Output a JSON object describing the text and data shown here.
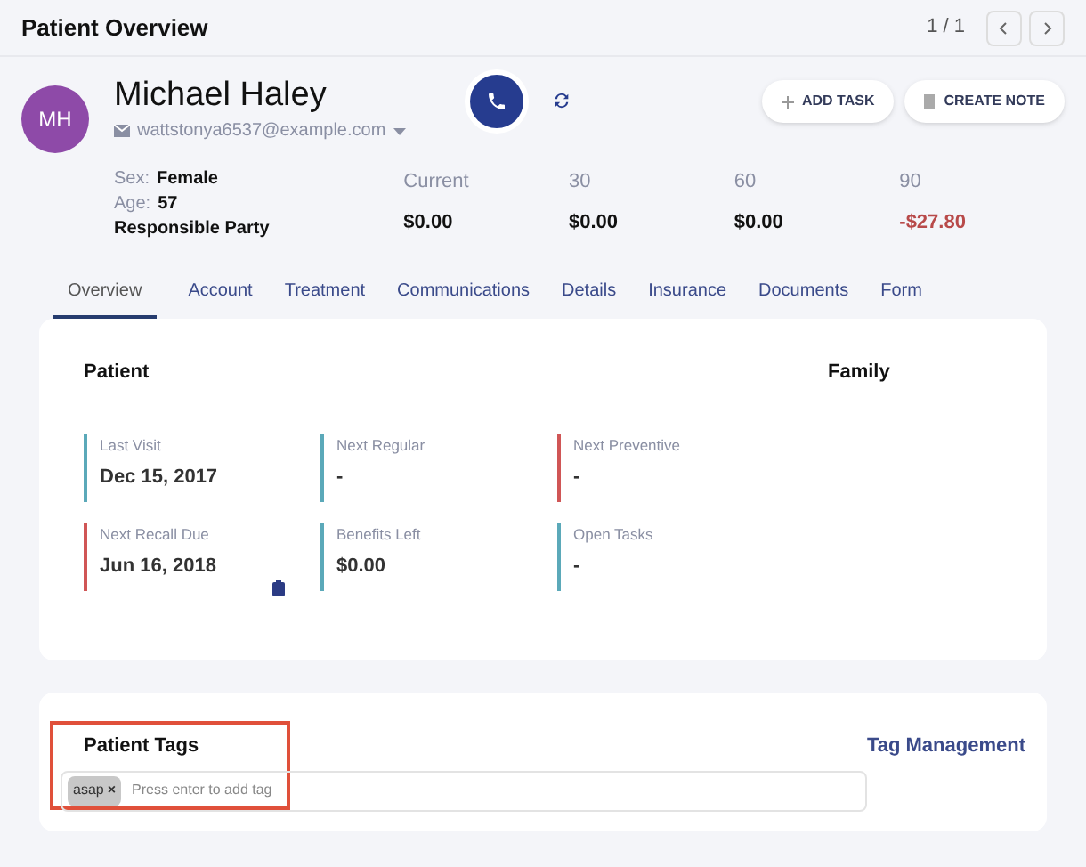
{
  "header": {
    "title": "Patient Overview",
    "pager": "1 / 1"
  },
  "patient": {
    "initials": "MH",
    "name": "Michael Haley",
    "email": "wattstonya6537@example.com",
    "info": [
      {
        "label": "Sex:",
        "value": "Female"
      },
      {
        "label": "Age:",
        "value": "57"
      }
    ],
    "responsible": "Responsible Party"
  },
  "actions": [
    "ADD TASK",
    "CREATE NOTE"
  ],
  "balances": [
    {
      "label": "Current",
      "amount": "$0.00",
      "color": "#111111"
    },
    {
      "label": "30",
      "amount": "$0.00",
      "color": "#111111"
    },
    {
      "label": "60",
      "amount": "$0.00",
      "color": "#111111"
    },
    {
      "label": "90",
      "amount": "-$27.80",
      "color": "#b84a4a"
    }
  ],
  "tabs": [
    {
      "label": "Overview",
      "selected": true
    },
    {
      "label": "Account",
      "selected": false
    },
    {
      "label": "Treatment",
      "selected": false
    },
    {
      "label": "Communications",
      "selected": false
    },
    {
      "label": "Details",
      "selected": false
    },
    {
      "label": "Insurance",
      "selected": false
    },
    {
      "label": "Documents",
      "selected": false
    },
    {
      "label": "Form",
      "selected": false
    }
  ],
  "overview": {
    "patient_heading": "Patient",
    "family_heading": "Family",
    "stats": [
      {
        "label": "Last Visit",
        "value": "Dec 15, 2017",
        "color": "#5ba9b9"
      },
      {
        "label": "Next Regular",
        "value": "-",
        "color": "#5ba9b9"
      },
      {
        "label": "Next Preventive",
        "value": "-",
        "color": "#d05656"
      },
      {
        "label": "Next Recall Due",
        "value": "Jun 16, 2018",
        "color": "#d05656"
      },
      {
        "label": "Benefits Left",
        "value": "$0.00",
        "color": "#5ba9b9"
      },
      {
        "label": "Open Tasks",
        "value": "-",
        "color": "#5ba9b9"
      }
    ]
  },
  "tags": {
    "heading": "Patient Tags",
    "link": "Tag Management",
    "items": [
      {
        "label": "asap",
        "remove": "×"
      }
    ],
    "placeholder": "Press enter to add tag"
  }
}
